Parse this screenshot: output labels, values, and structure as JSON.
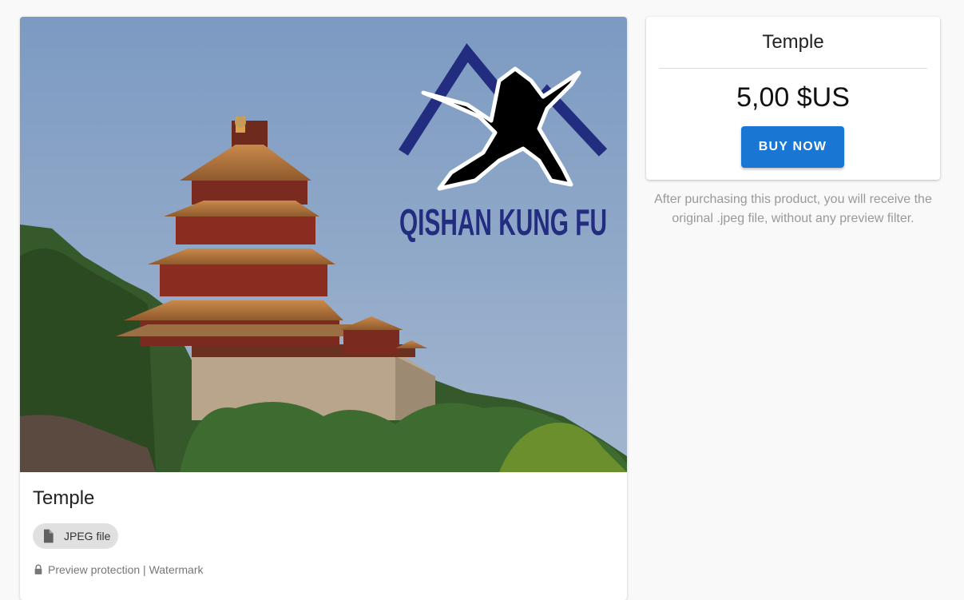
{
  "product": {
    "title": "Temple",
    "file_type_chip": "JPEG file",
    "file_icon": "file-icon",
    "protection_icon": "lock-icon",
    "protection_text": "Preview protection | Watermark",
    "image": {
      "watermark_logo_text": "QISHAN KUNG FU",
      "watermark_color": "#232d80"
    }
  },
  "purchase": {
    "title": "Temple",
    "price": "5,00 $US",
    "buy_label": "BUY NOW",
    "note": "After purchasing this product, you will receive the original .jpeg file, without any preview filter."
  },
  "colors": {
    "accent": "#1976d2",
    "background": "#f9f9f9"
  }
}
